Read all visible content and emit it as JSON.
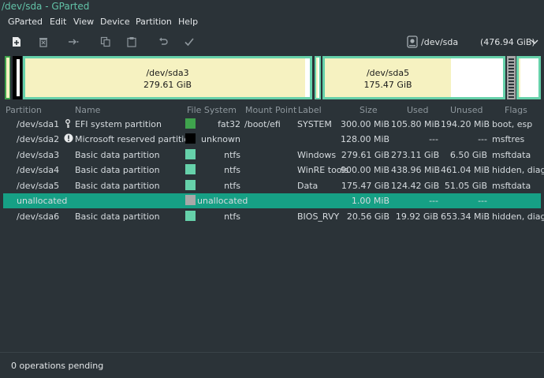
{
  "window": {
    "title": "/dev/sda - GParted"
  },
  "menu": [
    "GParted",
    "Edit",
    "View",
    "Device",
    "Partition",
    "Help"
  ],
  "toolbar": {
    "icons": [
      "new-icon",
      "delete-icon",
      "resize-move-icon",
      "copy-icon",
      "paste-icon",
      "undo-icon",
      "apply-icon"
    ]
  },
  "device": {
    "name": "/dev/sda",
    "size": "(476.94 GiB)"
  },
  "diskmap": {
    "sda3": {
      "name": "/dev/sda3",
      "size": "279.61 GiB"
    },
    "sda5": {
      "name": "/dev/sda5",
      "size": "175.47 GiB"
    }
  },
  "columns": [
    "Partition",
    "Name",
    "File System",
    "Mount Point",
    "Label",
    "Size",
    "Used",
    "Unused",
    "Flags"
  ],
  "rows": [
    {
      "partition": "/dev/sda1",
      "icon": "key-icon",
      "name": "EFI system partition",
      "fs": "fat32",
      "fs_color": "#3fa34d",
      "mount": "/boot/efi",
      "label": "SYSTEM",
      "size": "300.00 MiB",
      "used": "105.80 MiB",
      "unused": "194.20 MiB",
      "flags": "boot, esp"
    },
    {
      "partition": "/dev/sda2",
      "icon": "warning-icon",
      "name": "Microsoft reserved partition",
      "fs": "unknown",
      "fs_color": "#000000",
      "mount": "",
      "label": "",
      "size": "128.00 MiB",
      "used": "---",
      "unused": "---",
      "flags": "msftres"
    },
    {
      "partition": "/dev/sda3",
      "icon": "",
      "name": "Basic data partition",
      "fs": "ntfs",
      "fs_color": "#66d1aa",
      "mount": "",
      "label": "Windows",
      "size": "279.61 GiB",
      "used": "273.11 GiB",
      "unused": "6.50 GiB",
      "flags": "msftdata"
    },
    {
      "partition": "/dev/sda4",
      "icon": "",
      "name": "Basic data partition",
      "fs": "ntfs",
      "fs_color": "#66d1aa",
      "mount": "",
      "label": "WinRE tools",
      "size": "900.00 MiB",
      "used": "438.96 MiB",
      "unused": "461.04 MiB",
      "flags": "hidden, diag"
    },
    {
      "partition": "/dev/sda5",
      "icon": "",
      "name": "Basic data partition",
      "fs": "ntfs",
      "fs_color": "#66d1aa",
      "mount": "",
      "label": "Data",
      "size": "175.47 GiB",
      "used": "124.42 GiB",
      "unused": "51.05 GiB",
      "flags": "msftdata"
    },
    {
      "partition": "unallocated",
      "icon": "",
      "name": "",
      "fs": "unallocated",
      "fs_color": "#a8a8a8",
      "mount": "",
      "label": "",
      "size": "1.00 MiB",
      "used": "---",
      "unused": "---",
      "flags": "",
      "selected": true
    },
    {
      "partition": "/dev/sda6",
      "icon": "",
      "name": "Basic data partition",
      "fs": "ntfs",
      "fs_color": "#66d1aa",
      "mount": "",
      "label": "BIOS_RVY",
      "size": "20.56 GiB",
      "used": "19.92 GiB",
      "unused": "653.34 MiB",
      "flags": "hidden, diag"
    }
  ],
  "status": {
    "text": "0 operations pending"
  },
  "colors": {
    "accent": "#62c2a7",
    "selected_row": "#16a085",
    "used": "#f6f2c1",
    "ntfs": "#66d1aa",
    "fat32": "#3fa34d"
  }
}
